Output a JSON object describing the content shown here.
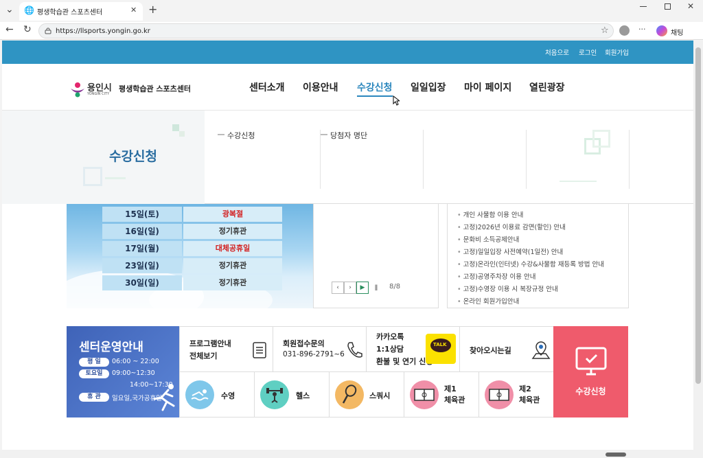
{
  "browser": {
    "tab_title": "평생학습관 스포츠센터",
    "url": "https://llsports.yongin.go.kr",
    "profile_label": "채팅",
    "new_tab": "+",
    "menu_dots": "···"
  },
  "topbar": {
    "home": "처음으로",
    "login": "로그인",
    "join": "회원가입"
  },
  "logo": {
    "city": "용인시",
    "city_en": "YONGIN CITY",
    "site": "평생학습관 스포츠센터"
  },
  "nav": [
    "센터소개",
    "이용안내",
    "수강신청",
    "일일입장",
    "마이 페이지",
    "열린광장"
  ],
  "mega": {
    "title": "수강신청",
    "items": [
      "수강신청",
      "당첨자 명단"
    ]
  },
  "calendar": [
    {
      "date": "15일(토)",
      "label": "광복절",
      "holiday": true
    },
    {
      "date": "16일(일)",
      "label": "정기휴관",
      "holiday": false
    },
    {
      "date": "17일(월)",
      "label": "대체공휴일",
      "holiday": true
    },
    {
      "date": "23일(일)",
      "label": "정기휴관",
      "holiday": false
    },
    {
      "date": "30일(일)",
      "label": "정기휴관",
      "holiday": false
    }
  ],
  "slider": {
    "counter": "8/8"
  },
  "notices": [
    "개인 사물함 이용 안내",
    "고정)2026년 이용료 감면(할인) 안내",
    "문화비 소득공제안내",
    "고정)일일입장 사전예약(1일전) 안내",
    "고정)온라인(인터넷) 수강&사물함 재등록 방법 안내",
    "고정)공영주차장 이용 안내",
    "고정)수영장 이용 시 복장규정 안내",
    "온라인 회원가입안내"
  ],
  "operation": {
    "title": "센터운영안내",
    "weekday_label": "평  일",
    "weekday": "06:00 ~ 22:00",
    "sat_label": "토요일",
    "sat1": "09:00~12:30",
    "sat2": "14:00~17:30",
    "holiday_label": "휴  관",
    "holiday": "일요일,국가공휴일"
  },
  "quick": {
    "program1": "프로그램안내",
    "program2": "전체보기",
    "phone_title": "회원접수문의",
    "phone": "031-896-2791~6",
    "kakao1": "카카오톡",
    "kakao2": "1:1상담",
    "kakao3": "환불 및 연기 신청",
    "talk_badge": "TALK",
    "map": "찾아오시는길"
  },
  "facilities": [
    {
      "l1": "수영",
      "l2": ""
    },
    {
      "l1": "헬스",
      "l2": ""
    },
    {
      "l1": "스쿼시",
      "l2": ""
    },
    {
      "l1": "제1",
      "l2": "체육관"
    },
    {
      "l1": "제2",
      "l2": "체육관"
    }
  ],
  "enroll": {
    "label": "수강신청"
  },
  "colors": {
    "topbar": "#2f94c3",
    "enroll": "#ef5b6c",
    "operation": "#4a6fc4"
  }
}
